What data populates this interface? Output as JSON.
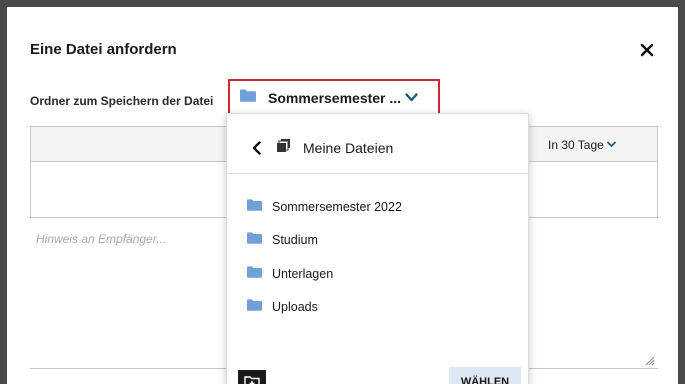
{
  "dialog": {
    "title": "Eine Datei anfordern"
  },
  "folder": {
    "label": "Ordner zum Speichern der Datei",
    "selected": "Sommersemester ..."
  },
  "table": {
    "expiry_label": "In 30 Tage"
  },
  "note": {
    "placeholder": "Hinweis an Empfänger..."
  },
  "dropdown": {
    "title": "Meine Dateien",
    "items": [
      {
        "label": "Sommersemester 2022"
      },
      {
        "label": "Studium"
      },
      {
        "label": "Unterlagen"
      },
      {
        "label": "Uploads"
      }
    ],
    "choose_label": "WÄHLEN"
  },
  "colors": {
    "accent_border": "#d0262e",
    "folder_icon": "#6fa0d8",
    "chevron": "#1f5a78",
    "choose_button_bg": "#dce8f3"
  }
}
